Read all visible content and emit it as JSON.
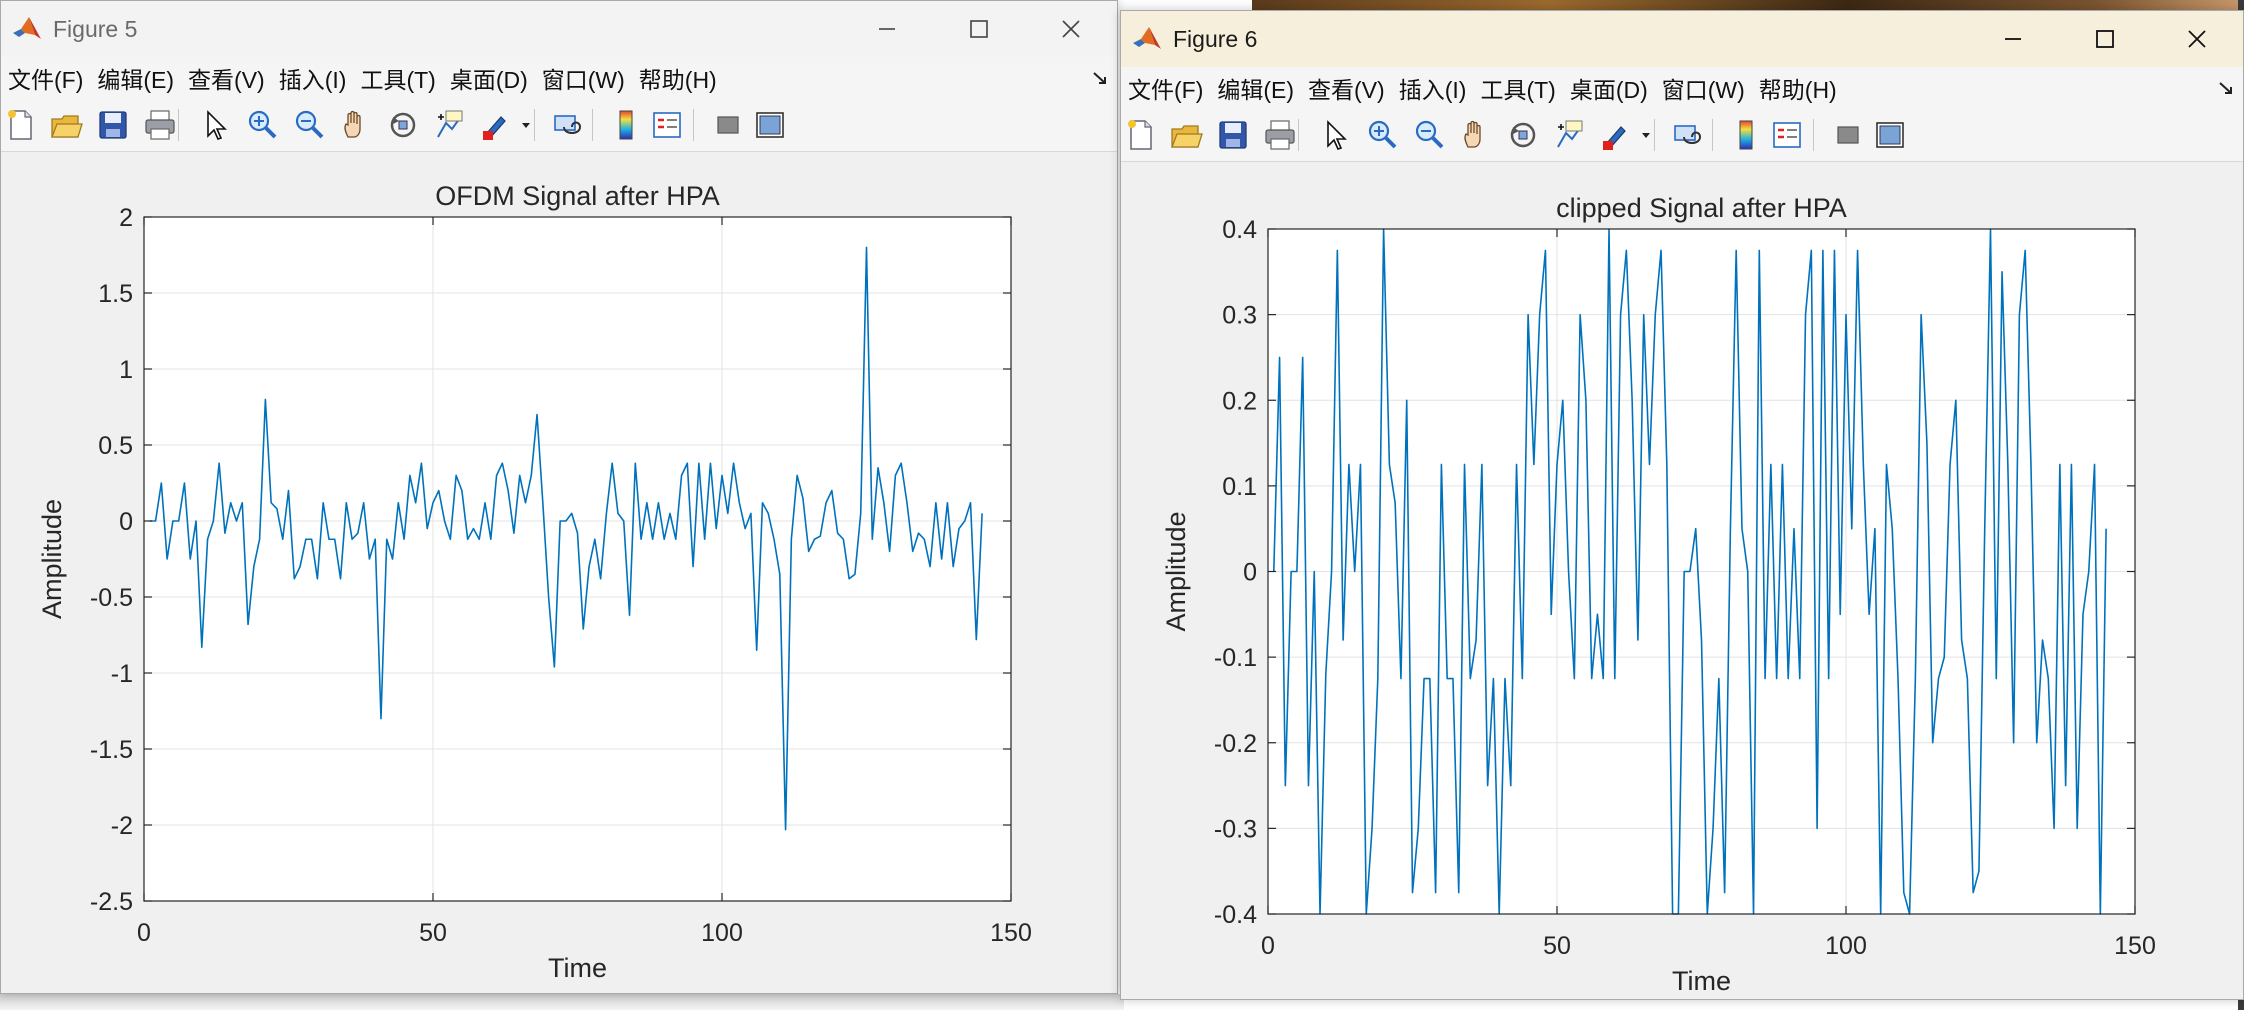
{
  "menu_items": [
    "文件(F)",
    "编辑(E)",
    "查看(V)",
    "插入(I)",
    "工具(T)",
    "桌面(D)",
    "窗口(W)",
    "帮助(H)"
  ],
  "toolbar_icons": [
    "new-figure-icon",
    "open-file-icon",
    "save-icon",
    "print-icon",
    "pointer-icon",
    "zoom-in-icon",
    "zoom-out-icon",
    "pan-hand-icon",
    "rotate-3d-icon",
    "data-cursor-icon",
    "brush-icon",
    "link-plot-icon",
    "colorbar-icon",
    "legend-icon",
    "hide-plot-tools-icon",
    "show-plot-tools-icon"
  ],
  "colors": {
    "line": "#0072bd",
    "grid": "#e3e3e3",
    "axes_box": "#262626",
    "figure_bg": "#f0f0f0"
  },
  "windows": [
    {
      "title": "Figure 5",
      "active": false
    },
    {
      "title": "Figure 6",
      "active": true
    }
  ],
  "chart_data": [
    {
      "type": "line",
      "title": "OFDM Signal after HPA",
      "xlabel": "Time",
      "ylabel": "Amplitude",
      "xlim": [
        0,
        150
      ],
      "ylim": [
        -2.5,
        2
      ],
      "xticks": [
        "0",
        "50",
        "100",
        "150"
      ],
      "yticks": [
        "-2.5",
        "-2",
        "-1.5",
        "-1",
        "-0.5",
        "0",
        "0.5",
        "1",
        "1.5",
        "2"
      ],
      "grid": true,
      "series": [
        {
          "values": [
            0,
            0,
            0.25,
            -0.25,
            0,
            0,
            0.25,
            -0.25,
            0,
            -0.83,
            -0.12,
            0,
            0.38,
            -0.08,
            0.12,
            0,
            0.12,
            -0.68,
            -0.3,
            -0.12,
            0.8,
            0.12,
            0.08,
            -0.12,
            0.2,
            -0.38,
            -0.3,
            -0.12,
            -0.12,
            -0.38,
            0.12,
            -0.12,
            -0.12,
            -0.38,
            0.12,
            -0.12,
            -0.08,
            0.12,
            -0.25,
            -0.12,
            -1.3,
            -0.12,
            -0.25,
            0.12,
            -0.12,
            0.3,
            0.12,
            0.38,
            -0.05,
            0.12,
            0.2,
            0,
            -0.12,
            0.3,
            0.2,
            -0.12,
            -0.05,
            -0.12,
            0.12,
            -0.12,
            0.3,
            0.38,
            0.2,
            -0.08,
            0.3,
            0.12,
            0.3,
            0.7,
            0.12,
            -0.5,
            -0.96,
            0,
            0,
            0.05,
            -0.08,
            -0.71,
            -0.3,
            -0.12,
            -0.38,
            0.05,
            0.38,
            0.05,
            0,
            -0.62,
            0.38,
            -0.12,
            0.12,
            -0.12,
            0.12,
            -0.12,
            0.05,
            -0.12,
            0.3,
            0.38,
            -0.3,
            0.38,
            -0.12,
            0.38,
            -0.05,
            0.3,
            0.05,
            0.38,
            0.12,
            -0.05,
            0.05,
            -0.85,
            0.12,
            0.05,
            -0.12,
            -0.35,
            -2.03,
            -0.12,
            0.3,
            0.15,
            -0.2,
            -0.12,
            -0.1,
            0.12,
            0.2,
            -0.08,
            -0.12,
            -0.38,
            -0.35,
            0.05,
            1.8,
            -0.12,
            0.35,
            0.12,
            -0.2,
            0.3,
            0.38,
            0.12,
            -0.2,
            -0.08,
            -0.12,
            -0.3,
            0.12,
            -0.25,
            0.12,
            -0.3,
            -0.05,
            0,
            0.12,
            -0.78,
            0.05
          ]
        }
      ]
    },
    {
      "type": "line",
      "title": "clipped Signal after HPA",
      "xlabel": "Time",
      "ylabel": "Amplitude",
      "xlim": [
        0,
        150
      ],
      "ylim": [
        -0.4,
        0.4
      ],
      "xticks": [
        "0",
        "50",
        "100",
        "150"
      ],
      "yticks": [
        "-0.4",
        "-0.3",
        "-0.2",
        "-0.1",
        "0",
        "0.1",
        "0.2",
        "0.3",
        "0.4"
      ],
      "grid": true,
      "series": [
        {
          "values": [
            0,
            0.25,
            -0.25,
            0,
            0,
            0.25,
            -0.25,
            0,
            -0.4,
            -0.12,
            0,
            0.375,
            -0.08,
            0.125,
            0,
            0.125,
            -0.4,
            -0.3,
            -0.125,
            0.4,
            0.125,
            0.08,
            -0.125,
            0.2,
            -0.375,
            -0.3,
            -0.125,
            -0.125,
            -0.375,
            0.125,
            -0.125,
            -0.125,
            -0.375,
            0.125,
            -0.125,
            -0.08,
            0.125,
            -0.25,
            -0.125,
            -0.4,
            -0.125,
            -0.25,
            0.125,
            -0.125,
            0.3,
            0.125,
            0.3,
            0.375,
            -0.05,
            0.125,
            0.2,
            0,
            -0.125,
            0.3,
            0.2,
            -0.125,
            -0.05,
            -0.125,
            0.4,
            -0.125,
            0.3,
            0.375,
            0.2,
            -0.08,
            0.3,
            0.125,
            0.3,
            0.375,
            0.125,
            -0.4,
            -0.4,
            0,
            0,
            0.05,
            -0.08,
            -0.4,
            -0.3,
            -0.125,
            -0.375,
            0.05,
            0.375,
            0.05,
            0,
            -0.4,
            0.375,
            -0.125,
            0.125,
            -0.125,
            0.125,
            -0.125,
            0.05,
            -0.125,
            0.3,
            0.375,
            -0.3,
            0.375,
            -0.125,
            0.375,
            -0.05,
            0.3,
            0.05,
            0.375,
            0.125,
            -0.05,
            0.05,
            -0.4,
            0.125,
            0.05,
            -0.125,
            -0.375,
            -0.4,
            -0.125,
            0.3,
            0.15,
            -0.2,
            -0.125,
            -0.1,
            0.125,
            0.2,
            -0.08,
            -0.125,
            -0.375,
            -0.35,
            0.05,
            0.4,
            -0.125,
            0.35,
            0.125,
            -0.2,
            0.3,
            0.375,
            0.125,
            -0.2,
            -0.08,
            -0.125,
            -0.3,
            0.125,
            -0.25,
            0.125,
            -0.3,
            -0.05,
            0,
            0.125,
            -0.4,
            0.05
          ]
        }
      ]
    }
  ]
}
